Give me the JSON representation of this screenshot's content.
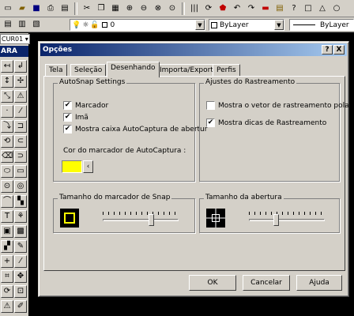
{
  "dialog": {
    "title": "Opções",
    "help_btn": "?",
    "close_btn": "X",
    "tabs": [
      {
        "label": "Tela"
      },
      {
        "label": "Seleção"
      },
      {
        "label": "Desenhando"
      },
      {
        "label": "Importa/Exporta"
      },
      {
        "label": "Perfis"
      }
    ],
    "autosnap": {
      "legend": "AutoSnap Settings",
      "marker": "Marcador",
      "magnet": "Imã",
      "tooltip": "Mostra caixa AutoCaptura de abertur",
      "color_label": "Cor do marcador de AutoCaptura :",
      "color": "#ffff00"
    },
    "tracking": {
      "legend": "Ajustes do Rastreamento",
      "polar_vector": "Mostra o vetor de rastreamento polar",
      "tooltips": "Mostra dicas de Rastreamento"
    },
    "snap_size": {
      "legend": "Tamanho do marcador de Snap",
      "level": 0.65
    },
    "aperture_size": {
      "legend": "Tamanho da abertura",
      "level": 0.35
    },
    "buttons": {
      "ok": "OK",
      "cancel": "Cancelar",
      "help": "Ajuda"
    }
  },
  "toolbar": {
    "layer_value": "0",
    "color_value": "ByLayer",
    "linetype_value": "ByLayer"
  },
  "left": {
    "cmd_combo": "CUR01",
    "cmd_title": "ARA"
  }
}
